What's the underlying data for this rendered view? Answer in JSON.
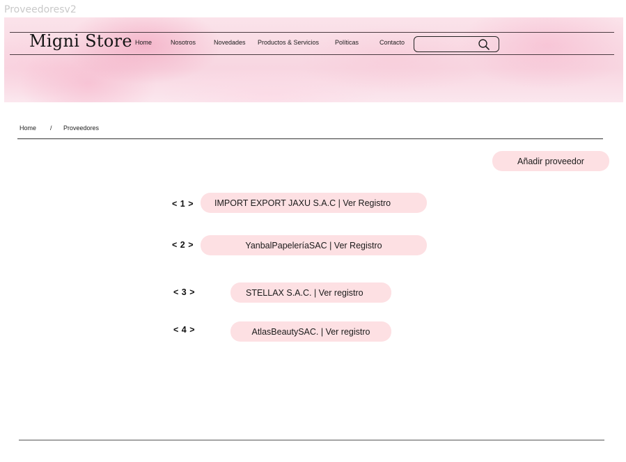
{
  "frame_title": "Proveedoresv2",
  "header": {
    "brand": "Migni Store",
    "nav": [
      "Home",
      "Nosotros",
      "Novedades",
      "Productos & Servicios",
      "Políticas",
      "Contacto"
    ],
    "search": {
      "value": "",
      "placeholder": ""
    }
  },
  "breadcrumb": {
    "home": "Home",
    "separator": "/",
    "current": "Proveedores"
  },
  "actions": {
    "add_supplier": "Añadir proveedor"
  },
  "suppliers": [
    {
      "index": "< 1 >",
      "label": "IMPORT EXPORT JAXU S.A.C | Ver Registro"
    },
    {
      "index": "< 2 >",
      "label": "YanbalPapeleríaSAC | Ver Registro"
    },
    {
      "index": "< 3 >",
      "label": "STELLAX S.A.C. | Ver registro"
    },
    {
      "index": "< 4 >",
      "label": "AtlasBeautySAC. | Ver registro"
    }
  ],
  "colors": {
    "pill": "#fde0e3",
    "hero": "#f8d6e1",
    "text": "#111111"
  }
}
